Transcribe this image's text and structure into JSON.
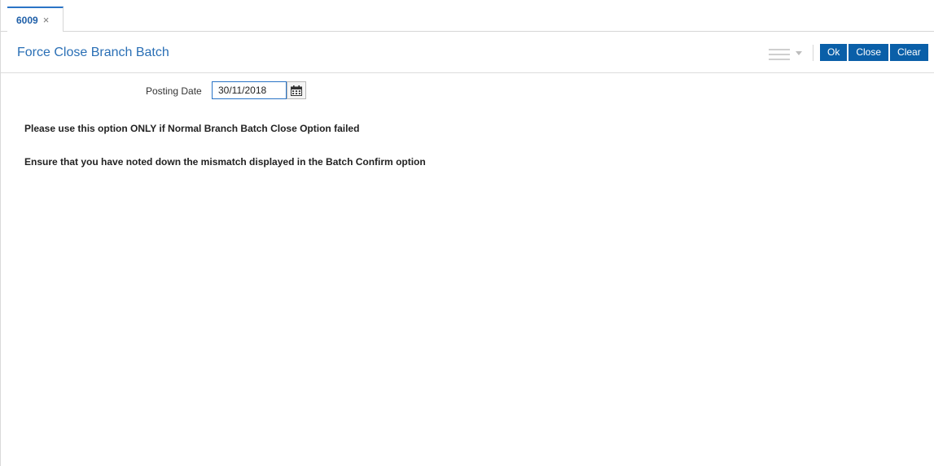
{
  "tabs": [
    {
      "label": "6009",
      "close_icon": "close-icon",
      "close_glyph": "×"
    }
  ],
  "header": {
    "title": "Force Close Branch Batch",
    "menu_icon": "hamburger-menu-icon",
    "dropdown_icon": "chevron-down-icon",
    "buttons": {
      "ok_label": "Ok",
      "close_label": "Close",
      "clear_label": "Clear"
    }
  },
  "form": {
    "posting_date_label": "Posting Date",
    "posting_date_value": "30/11/2018",
    "calendar_icon": "calendar-icon"
  },
  "messages": {
    "line1": "Please use this option ONLY if Normal Branch Batch Close Option failed",
    "line2": "Ensure that you have noted down the mismatch displayed in the Batch Confirm option"
  },
  "colors": {
    "accent": "#2a74c6",
    "button_bg": "#0a5fa8",
    "title": "#2a6fb5"
  }
}
